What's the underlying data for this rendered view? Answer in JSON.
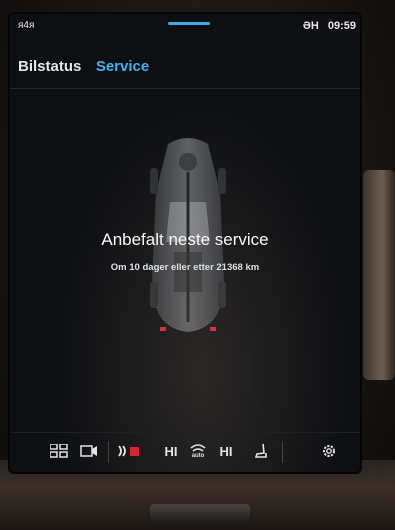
{
  "status_bar": {
    "left_text": "ᴙ4ᴙ",
    "profile_text": "ƏH",
    "clock": "09:59"
  },
  "header": {
    "tabs": [
      {
        "label": "Bilstatus",
        "active": false
      },
      {
        "label": "Service",
        "active": true
      }
    ]
  },
  "service": {
    "title": "Anbefalt neste service",
    "subtitle": "Om 10 dager eller etter 21368 km"
  },
  "climate_bar": {
    "left_heat_label": "HI",
    "right_heat_label": "HI",
    "fan_label": "auto"
  },
  "colors": {
    "accent": "#3fb3ef",
    "active_red": "#d9232e",
    "screen_bg": "#0d0f12"
  }
}
